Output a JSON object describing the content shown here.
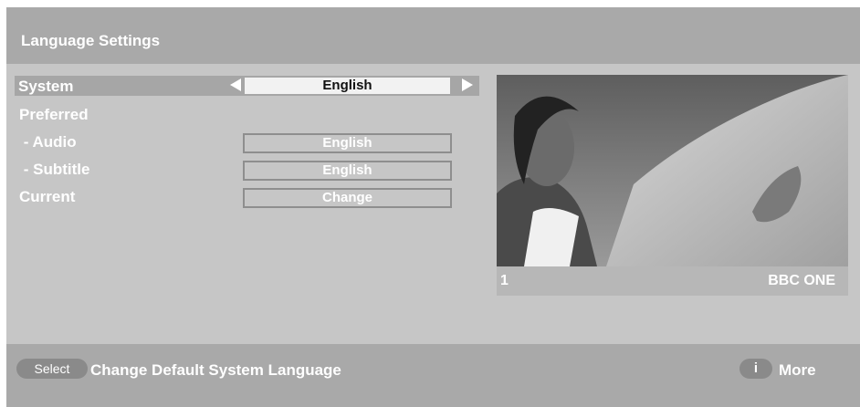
{
  "header": {
    "title": "Language Settings"
  },
  "menu": {
    "system": {
      "label": "System",
      "value": "English"
    },
    "preferred": {
      "label": "Preferred"
    },
    "audio": {
      "label": " - Audio",
      "value": "English"
    },
    "subtitle": {
      "label": " - Subtitle",
      "value": "English"
    },
    "current": {
      "label": "Current",
      "value": "Change"
    }
  },
  "preview": {
    "channel_number": "1",
    "channel_name": "BBC ONE"
  },
  "footer": {
    "select_label": "Select",
    "hint": "Change Default System Language",
    "info_label": "i",
    "more_label": "More"
  },
  "icons": {
    "left": "arrow-left-icon",
    "right": "arrow-right-icon",
    "info": "info-icon"
  }
}
